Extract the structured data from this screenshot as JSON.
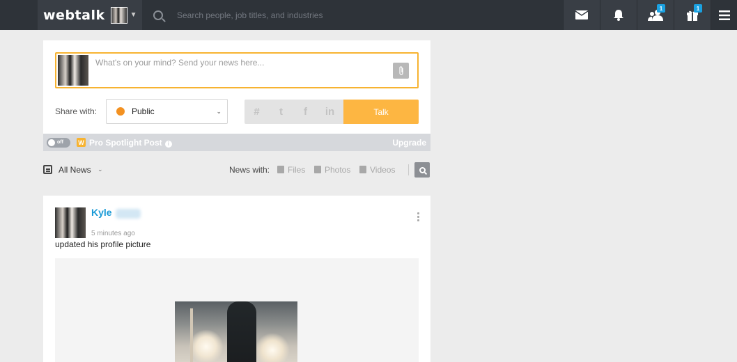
{
  "header": {
    "logo": "webtalk",
    "search_placeholder": "Search people, job titles, and industries",
    "icons": [
      {
        "name": "mail-icon"
      },
      {
        "name": "bell-icon"
      },
      {
        "name": "contacts-icon",
        "badge": "1"
      },
      {
        "name": "gift-icon",
        "badge": "1"
      },
      {
        "name": "menu-icon"
      }
    ],
    "accent": "#1aa1e1"
  },
  "composer": {
    "placeholder": "What's on your mind? Send your news here...",
    "share_label": "Share with:",
    "share_value": "Public",
    "social": [
      "#",
      "t",
      "f",
      "in"
    ],
    "talk_label": "Talk",
    "toggle_label": "off",
    "spotlight_badge": "W",
    "spotlight_label": "Pro Spotlight Post",
    "upgrade_label": "Upgrade",
    "accent": "#fdb642"
  },
  "filters": {
    "all_news": "All News",
    "news_with": "News with:",
    "items": [
      "Files",
      "Photos",
      "Videos"
    ]
  },
  "feed": {
    "author": "Kyle",
    "time": "5 minutes ago",
    "text": "updated his profile picture",
    "name_color": "#1a9ad6"
  }
}
